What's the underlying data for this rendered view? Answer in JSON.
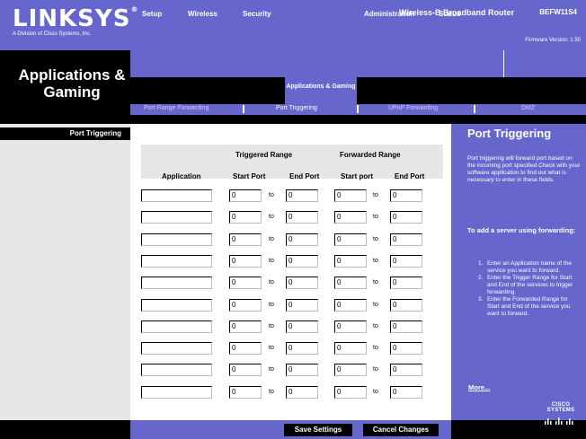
{
  "header": {
    "logo_text": "LINKSYS",
    "logo_reg": "®",
    "logo_sub": "A Division of Cisco Systems, Inc.",
    "firmware": "Firmware Version: 1.50",
    "section_title": "Applications & Gaming",
    "product_name": "Wireless-B Broadband Router",
    "model": "BEFW11S4"
  },
  "menu": {
    "items": [
      "Setup",
      "Wireless",
      "Security",
      "Administration",
      "Status"
    ],
    "active": "Applications & Gaming"
  },
  "submenu": {
    "items": [
      "Port Range Forwarding",
      "Port Triggering",
      "UPnP Forwarding",
      "DMZ"
    ],
    "active_index": 1
  },
  "left": {
    "label": "Port Triggering"
  },
  "table": {
    "group_triggered": "Triggered Range",
    "group_forwarded": "Forwarded Range",
    "col_application": "Application",
    "col_start": "Start Port",
    "col_end": "End Port",
    "col_fstart": "Start port",
    "col_fend": "End Port",
    "to_label": "to",
    "rows": [
      {
        "app": "",
        "t_start": "0",
        "t_end": "0",
        "f_start": "0",
        "f_end": "0"
      },
      {
        "app": "",
        "t_start": "0",
        "t_end": "0",
        "f_start": "0",
        "f_end": "0"
      },
      {
        "app": "",
        "t_start": "0",
        "t_end": "0",
        "f_start": "0",
        "f_end": "0"
      },
      {
        "app": "",
        "t_start": "0",
        "t_end": "0",
        "f_start": "0",
        "f_end": "0"
      },
      {
        "app": "",
        "t_start": "0",
        "t_end": "0",
        "f_start": "0",
        "f_end": "0"
      },
      {
        "app": "",
        "t_start": "0",
        "t_end": "0",
        "f_start": "0",
        "f_end": "0"
      },
      {
        "app": "",
        "t_start": "0",
        "t_end": "0",
        "f_start": "0",
        "f_end": "0"
      },
      {
        "app": "",
        "t_start": "0",
        "t_end": "0",
        "f_start": "0",
        "f_end": "0"
      },
      {
        "app": "",
        "t_start": "0",
        "t_end": "0",
        "f_start": "0",
        "f_end": "0"
      },
      {
        "app": "",
        "t_start": "0",
        "t_end": "0",
        "f_start": "0",
        "f_end": "0"
      }
    ]
  },
  "help": {
    "title": "Port Triggering",
    "text": "Port triggering will forward port based on the incoming port specified.Check with your software application to find out what is necessary to enter in these fields.",
    "subtitle": "To add a server using forwarding:",
    "steps": [
      "Enter an Application name of the service you want to forward.",
      "Enter the Trigger Range for Start and End of the services to trigger forwarding.",
      "Enter the Forwarded Range for Start and End of the service you want to forward."
    ],
    "step_numbers": [
      "1.",
      "2.",
      "3."
    ],
    "more": "More..."
  },
  "footer": {
    "save": "Save Settings",
    "cancel": "Cancel Changes",
    "cisco": "CISCO SYSTEMS"
  },
  "colors": {
    "brand_purple": "#6666cc",
    "black": "#000000",
    "light_gray": "#e6e6e6"
  }
}
